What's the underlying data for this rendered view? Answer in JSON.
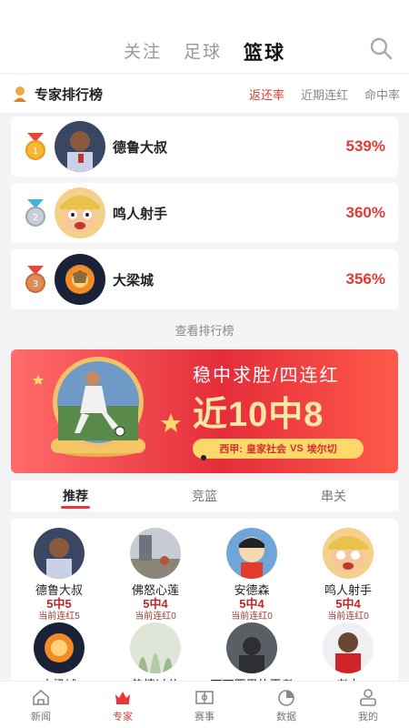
{
  "header": {
    "tabs": [
      {
        "label": "关注",
        "active": false
      },
      {
        "label": "足球",
        "active": false
      },
      {
        "label": "篮球",
        "active": true
      }
    ],
    "search_icon": "search-icon"
  },
  "ranking": {
    "title": "专家排行榜",
    "sort_tabs": [
      {
        "label": "返还率",
        "active": true
      },
      {
        "label": "近期连红",
        "active": false
      },
      {
        "label": "命中率",
        "active": false
      }
    ],
    "rows": [
      {
        "rank": 1,
        "name": "德鲁大叔",
        "rate": "539%",
        "medal": "gold-medal-icon"
      },
      {
        "rank": 2,
        "name": "鸣人射手",
        "rate": "360%",
        "medal": "silver-medal-icon"
      },
      {
        "rank": 3,
        "name": "大梁城",
        "rate": "356%",
        "medal": "bronze-medal-icon"
      }
    ],
    "view_more": "查看排行榜"
  },
  "banner": {
    "title": "稳中求胜/四连红",
    "headline": "近10中8",
    "league": "西甲:",
    "home": "皇家社会",
    "vs": "VS",
    "away": "埃尔切"
  },
  "sub_tabs": [
    {
      "label": "推荐",
      "active": true
    },
    {
      "label": "竞篮",
      "active": false
    },
    {
      "label": "串关",
      "active": false
    }
  ],
  "experts": [
    {
      "name": "德鲁大叔",
      "record": "5中5",
      "streak": "当前连红5"
    },
    {
      "name": "佛怒心莲",
      "record": "5中4",
      "streak": "当前连红0"
    },
    {
      "name": "安德森",
      "record": "5中4",
      "streak": "当前连红0"
    },
    {
      "name": "鸣人射手",
      "record": "5中4",
      "streak": "当前连红0"
    },
    {
      "name": "大梁城",
      "record": "",
      "streak": ""
    },
    {
      "name": "热情过分",
      "record": "",
      "streak": ""
    },
    {
      "name": "可可西里的王者",
      "record": "",
      "streak": ""
    },
    {
      "name": "老木",
      "record": "",
      "streak": ""
    }
  ],
  "bottom_nav": [
    {
      "label": "新闻",
      "icon": "home-icon",
      "active": false
    },
    {
      "label": "专家",
      "icon": "crown-icon",
      "active": true
    },
    {
      "label": "赛事",
      "icon": "field-icon",
      "active": false
    },
    {
      "label": "数据",
      "icon": "pie-chart-icon",
      "active": false
    },
    {
      "label": "我的",
      "icon": "user-icon",
      "active": false
    }
  ],
  "colors": {
    "accent": "#e53935",
    "banner": "#e52d3a",
    "gold": "#ffd86b"
  }
}
